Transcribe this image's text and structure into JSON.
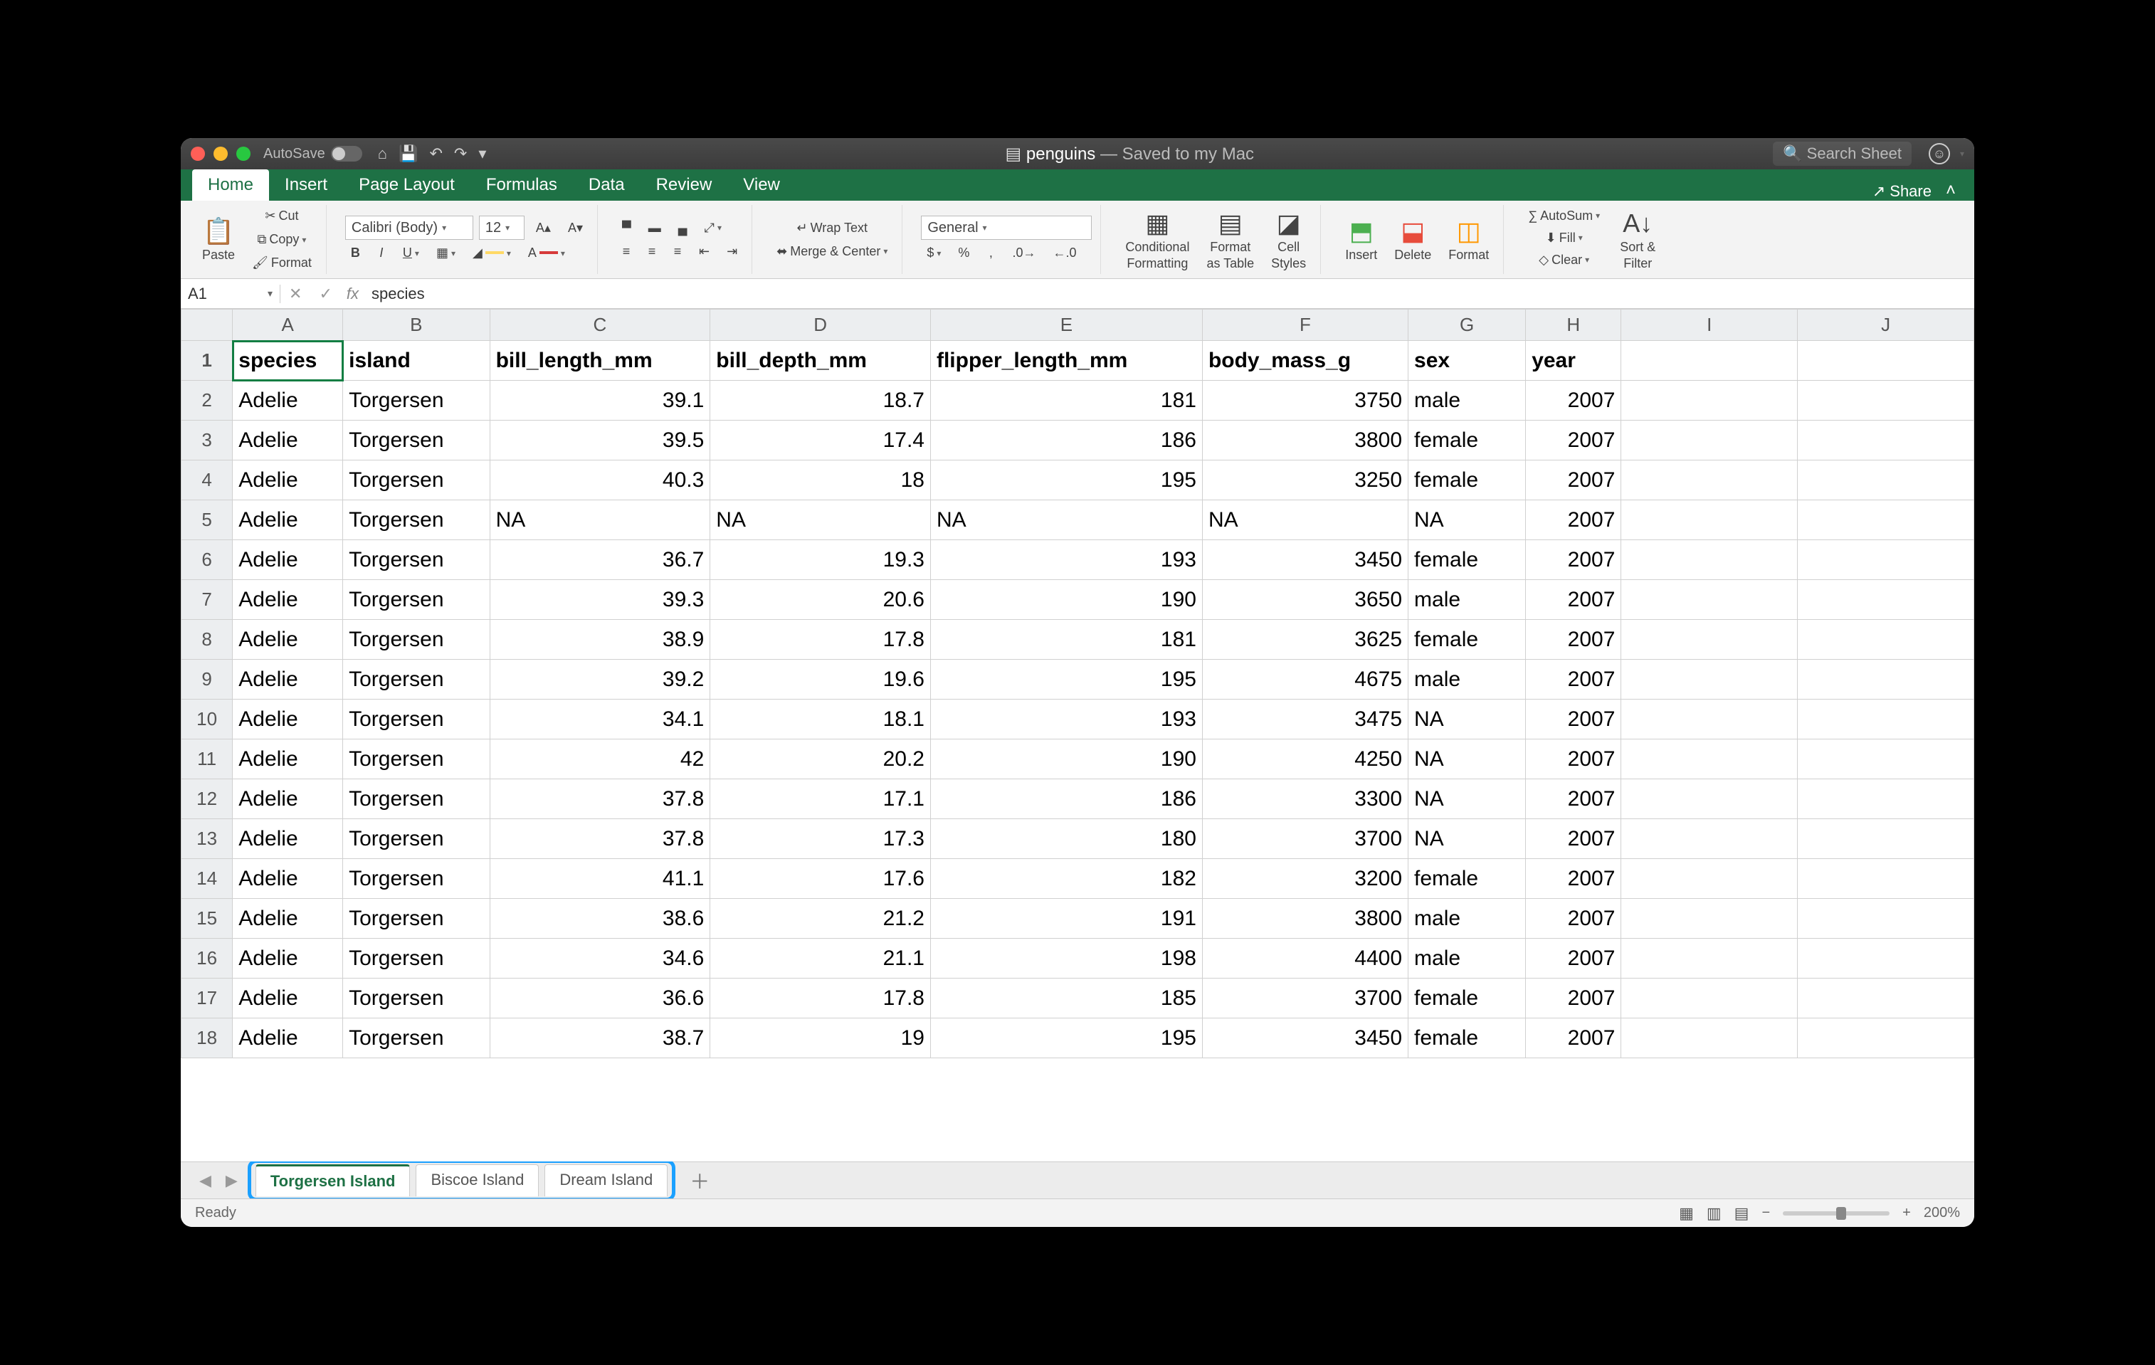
{
  "titlebar": {
    "autosave_label": "AutoSave",
    "filename": "penguins",
    "saved_status": " — Saved to my Mac",
    "search_placeholder": "Search Sheet"
  },
  "ribbon_tabs": [
    "Home",
    "Insert",
    "Page Layout",
    "Formulas",
    "Data",
    "Review",
    "View"
  ],
  "active_tab": "Home",
  "share_label": "Share",
  "clipboard": {
    "paste": "Paste",
    "cut": "Cut",
    "copy": "Copy",
    "format": "Format"
  },
  "font": {
    "name": "Calibri (Body)",
    "size": "12"
  },
  "alignment": {
    "wrap": "Wrap Text",
    "merge": "Merge & Center"
  },
  "number_format": "General",
  "cells": {
    "insert": "Insert",
    "delete": "Delete",
    "format": "Format"
  },
  "styles": {
    "cond": "Conditional",
    "cond2": "Formatting",
    "table": "Format",
    "table2": "as Table",
    "cell": "Cell",
    "cell2": "Styles"
  },
  "editing": {
    "autosum": "AutoSum",
    "fill": "Fill",
    "clear": "Clear",
    "sort": "Sort &",
    "sort2": "Filter"
  },
  "formula_bar": {
    "cell_ref": "A1",
    "formula": "species"
  },
  "columns": [
    "A",
    "B",
    "C",
    "D",
    "E",
    "F",
    "G",
    "H",
    "I",
    "J"
  ],
  "headers": [
    "species",
    "island",
    "bill_length_mm",
    "bill_depth_mm",
    "flipper_length_mm",
    "body_mass_g",
    "sex",
    "year"
  ],
  "rows": [
    {
      "n": 2,
      "species": "Adelie",
      "island": "Torgersen",
      "bill_length": "39.1",
      "bill_depth": "18.7",
      "flipper": "181",
      "mass": "3750",
      "sex": "male",
      "year": "2007"
    },
    {
      "n": 3,
      "species": "Adelie",
      "island": "Torgersen",
      "bill_length": "39.5",
      "bill_depth": "17.4",
      "flipper": "186",
      "mass": "3800",
      "sex": "female",
      "year": "2007"
    },
    {
      "n": 4,
      "species": "Adelie",
      "island": "Torgersen",
      "bill_length": "40.3",
      "bill_depth": "18",
      "flipper": "195",
      "mass": "3250",
      "sex": "female",
      "year": "2007"
    },
    {
      "n": 5,
      "species": "Adelie",
      "island": "Torgersen",
      "bill_length": "NA",
      "bill_depth": "NA",
      "flipper": "NA",
      "mass": "NA",
      "sex": "NA",
      "year": "2007",
      "na": true
    },
    {
      "n": 6,
      "species": "Adelie",
      "island": "Torgersen",
      "bill_length": "36.7",
      "bill_depth": "19.3",
      "flipper": "193",
      "mass": "3450",
      "sex": "female",
      "year": "2007"
    },
    {
      "n": 7,
      "species": "Adelie",
      "island": "Torgersen",
      "bill_length": "39.3",
      "bill_depth": "20.6",
      "flipper": "190",
      "mass": "3650",
      "sex": "male",
      "year": "2007"
    },
    {
      "n": 8,
      "species": "Adelie",
      "island": "Torgersen",
      "bill_length": "38.9",
      "bill_depth": "17.8",
      "flipper": "181",
      "mass": "3625",
      "sex": "female",
      "year": "2007"
    },
    {
      "n": 9,
      "species": "Adelie",
      "island": "Torgersen",
      "bill_length": "39.2",
      "bill_depth": "19.6",
      "flipper": "195",
      "mass": "4675",
      "sex": "male",
      "year": "2007"
    },
    {
      "n": 10,
      "species": "Adelie",
      "island": "Torgersen",
      "bill_length": "34.1",
      "bill_depth": "18.1",
      "flipper": "193",
      "mass": "3475",
      "sex": "NA",
      "year": "2007"
    },
    {
      "n": 11,
      "species": "Adelie",
      "island": "Torgersen",
      "bill_length": "42",
      "bill_depth": "20.2",
      "flipper": "190",
      "mass": "4250",
      "sex": "NA",
      "year": "2007"
    },
    {
      "n": 12,
      "species": "Adelie",
      "island": "Torgersen",
      "bill_length": "37.8",
      "bill_depth": "17.1",
      "flipper": "186",
      "mass": "3300",
      "sex": "NA",
      "year": "2007"
    },
    {
      "n": 13,
      "species": "Adelie",
      "island": "Torgersen",
      "bill_length": "37.8",
      "bill_depth": "17.3",
      "flipper": "180",
      "mass": "3700",
      "sex": "NA",
      "year": "2007"
    },
    {
      "n": 14,
      "species": "Adelie",
      "island": "Torgersen",
      "bill_length": "41.1",
      "bill_depth": "17.6",
      "flipper": "182",
      "mass": "3200",
      "sex": "female",
      "year": "2007"
    },
    {
      "n": 15,
      "species": "Adelie",
      "island": "Torgersen",
      "bill_length": "38.6",
      "bill_depth": "21.2",
      "flipper": "191",
      "mass": "3800",
      "sex": "male",
      "year": "2007"
    },
    {
      "n": 16,
      "species": "Adelie",
      "island": "Torgersen",
      "bill_length": "34.6",
      "bill_depth": "21.1",
      "flipper": "198",
      "mass": "4400",
      "sex": "male",
      "year": "2007"
    },
    {
      "n": 17,
      "species": "Adelie",
      "island": "Torgersen",
      "bill_length": "36.6",
      "bill_depth": "17.8",
      "flipper": "185",
      "mass": "3700",
      "sex": "female",
      "year": "2007"
    },
    {
      "n": 18,
      "species": "Adelie",
      "island": "Torgersen",
      "bill_length": "38.7",
      "bill_depth": "19",
      "flipper": "195",
      "mass": "3450",
      "sex": "female",
      "year": "2007"
    }
  ],
  "sheet_tabs": [
    "Torgersen Island",
    "Biscoe Island",
    "Dream Island"
  ],
  "active_sheet": 0,
  "status": {
    "ready": "Ready",
    "zoom": "200%"
  }
}
